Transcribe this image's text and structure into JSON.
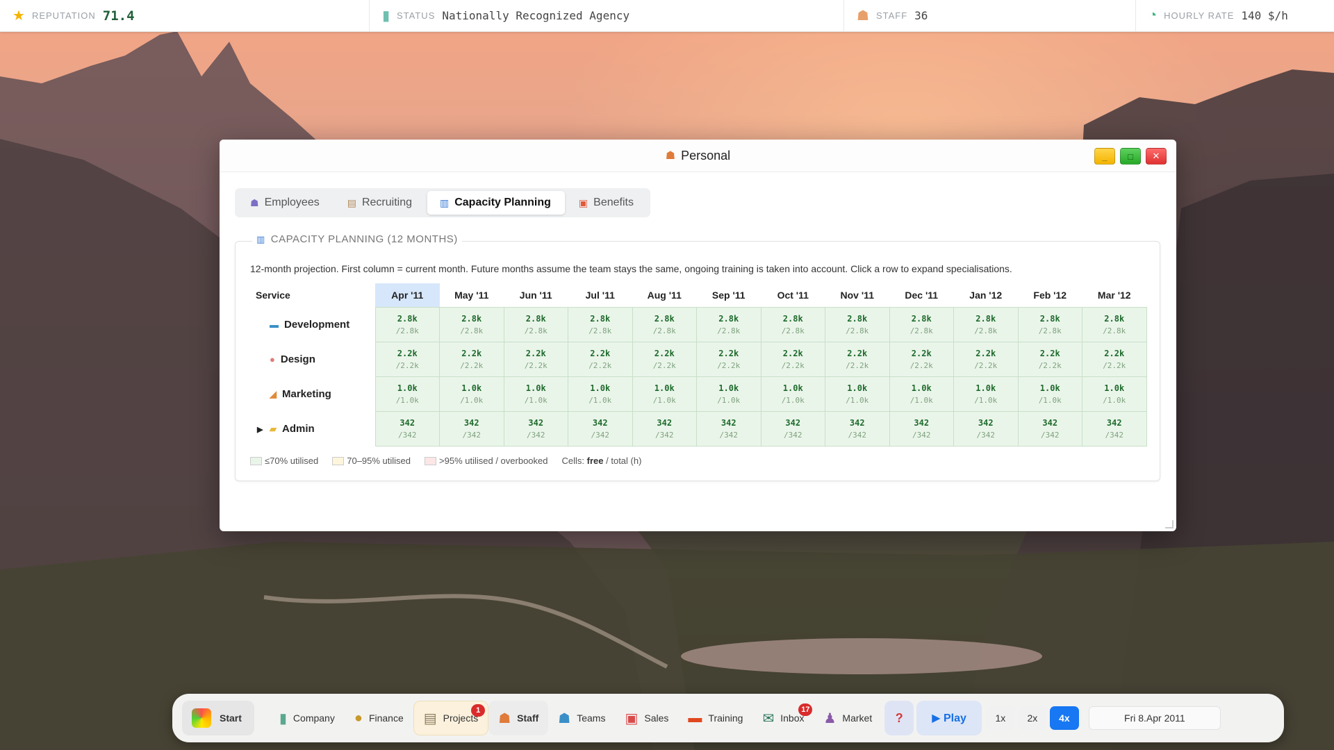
{
  "topbar": {
    "reputation": {
      "icon": "star-icon",
      "label": "REPUTATION",
      "value": "71.4"
    },
    "status": {
      "icon": "building-icon",
      "label": "STATUS",
      "value": "Nationally Recognized Agency"
    },
    "staff": {
      "icon": "people-icon",
      "label": "STAFF",
      "value": "36"
    },
    "rate": {
      "icon": "stopwatch-icon",
      "label": "HOURLY RATE",
      "value": "140 $/h"
    }
  },
  "window": {
    "title": "Personal",
    "title_icon": "people-icon",
    "buttons": {
      "minimize": "_",
      "maximize": "□",
      "close": "✕"
    }
  },
  "tabs": [
    {
      "label": "Employees",
      "icon": "people-icon",
      "active": false
    },
    {
      "label": "Recruiting",
      "icon": "clipboard-icon",
      "active": false
    },
    {
      "label": "Capacity Planning",
      "icon": "bar-chart-icon",
      "active": true
    },
    {
      "label": "Benefits",
      "icon": "gift-icon",
      "active": false
    }
  ],
  "panel": {
    "title": "CAPACITY PLANNING (12 MONTHS)",
    "description": "12-month projection. First column = current month. Future months assume the team stays the same, ongoing training is taken into account. Click a row to expand specialisations.",
    "table": {
      "service_header": "Service",
      "months": [
        "Apr '11",
        "May '11",
        "Jun '11",
        "Jul '11",
        "Aug '11",
        "Sep '11",
        "Oct '11",
        "Nov '11",
        "Dec '11",
        "Jan '12",
        "Feb '12",
        "Mar '12"
      ],
      "rows": [
        {
          "name": "Development",
          "icon": "monitor-icon",
          "arrow": "",
          "free": "2.8k",
          "total": "/2.8k"
        },
        {
          "name": "Design",
          "icon": "palette-icon",
          "arrow": "",
          "free": "2.2k",
          "total": "/2.2k"
        },
        {
          "name": "Marketing",
          "icon": "megaphone-icon",
          "arrow": "",
          "free": "1.0k",
          "total": "/1.0k"
        },
        {
          "name": "Admin",
          "icon": "folder-icon",
          "arrow": "▶",
          "free": "342",
          "total": "/342"
        }
      ]
    },
    "legend": {
      "low": "≤70% utilised",
      "mid": "70–95% utilised",
      "high": ">95% utilised / overbooked",
      "cells_prefix": "Cells:",
      "cells_free": "free",
      "cells_suffix": "/ total (h)",
      "colors": {
        "low": "#eaf5ea",
        "mid": "#fdf6dc",
        "high": "#fde6e6"
      }
    }
  },
  "taskbar": {
    "start": "Start",
    "items": [
      {
        "label": "Company",
        "icon": "building-icon"
      },
      {
        "label": "Finance",
        "icon": "money-bag-icon"
      },
      {
        "label": "Projects",
        "icon": "clipboard-icon",
        "badge": "1"
      },
      {
        "label": "Staff",
        "icon": "people-icon"
      },
      {
        "label": "Teams",
        "icon": "teams-icon"
      },
      {
        "label": "Sales",
        "icon": "briefcase-icon"
      },
      {
        "label": "Training",
        "icon": "training-icon"
      },
      {
        "label": "Inbox",
        "icon": "mail-icon",
        "badge": "17"
      },
      {
        "label": "Market",
        "icon": "market-icon"
      }
    ],
    "help": "?",
    "play": "▶ Play",
    "speeds": [
      "1x",
      "2x",
      "4x"
    ],
    "active_speed": "4x",
    "date": "Fri 8.Apr 2011"
  },
  "colors": {
    "accent": "#1877f2",
    "current_month": "#d7e7fb",
    "reputation": "#22603a"
  }
}
